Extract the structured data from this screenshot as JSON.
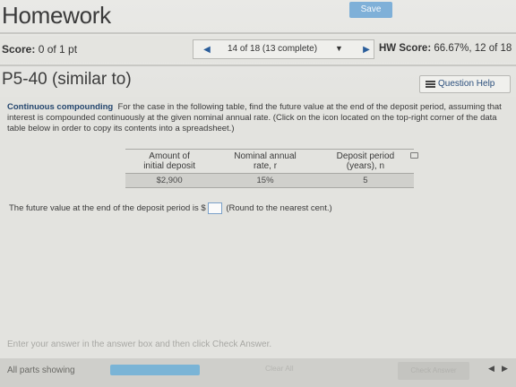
{
  "header": {
    "title": "Homework",
    "save_label": "Save"
  },
  "score_row": {
    "score_label": "Score:",
    "score_value": "0 of 1 pt",
    "nav_prev": "◀",
    "nav_text": "14 of 18 (13 complete)",
    "nav_dropdown": "▼",
    "nav_next": "▶",
    "hw_score_label": "HW Score:",
    "hw_score_value": "66.67%, 12 of 18"
  },
  "problem": {
    "title": "P5-40 (similar to)",
    "help_label": "Question Help",
    "help_icon": "list-icon"
  },
  "instructions": {
    "heading": "Continuous compounding",
    "text": "For the case in the following table, find the future value at the end of the deposit period, assuming that interest is compounded continuously at the given nominal annual rate. (Click on the icon located on the top-right corner of the data table below in order to copy its contents into a spreadsheet.)"
  },
  "table": {
    "headers": [
      [
        "Amount of",
        "initial deposit"
      ],
      [
        "Nominal annual",
        "rate, r"
      ],
      [
        "Deposit period",
        "(years), n"
      ]
    ],
    "rows": [
      [
        "$2,900",
        "15%",
        "5"
      ]
    ],
    "copy_icon": "copy-icon"
  },
  "answer": {
    "prefix": "The future value at the end of the deposit period is $",
    "suffix": "(Round to the nearest cent.)",
    "value": ""
  },
  "footer": {
    "hint": "Enter your answer in the answer box and then click Check Answer.",
    "parts_label": "All parts showing",
    "clear_label": "Clear All",
    "check_label": "Check Answer",
    "prev": "◀",
    "next": "▶"
  }
}
